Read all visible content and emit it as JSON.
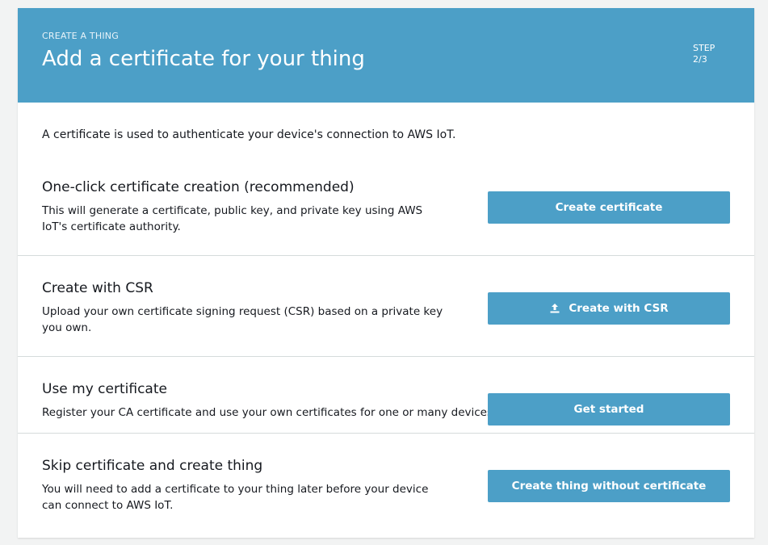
{
  "header": {
    "kicker": "CREATE A THING",
    "title": "Add a certificate for your thing",
    "step_label": "STEP",
    "step_value": "2/3",
    "color": "#4c9fc7"
  },
  "intro": "A certificate is used to authenticate your device's connection to AWS IoT.",
  "sections": [
    {
      "title": "One-click certificate creation (recommended)",
      "description": "This will generate a certificate, public key, and private key using AWS IoT's certificate authority.",
      "button": "Create certificate"
    },
    {
      "title": "Create with CSR",
      "description": "Upload your own certificate signing request (CSR) based on a private key you own.",
      "button": "Create with CSR",
      "button_icon": "upload-icon"
    },
    {
      "title": "Use my certificate",
      "description": "Register your CA certificate and use your own certificates for one or many devices.",
      "button": "Get started"
    },
    {
      "title": "Skip certificate and create thing",
      "description": "You will need to add a certificate to your thing later before your device can connect to AWS IoT.",
      "button": "Create thing without certificate"
    }
  ]
}
